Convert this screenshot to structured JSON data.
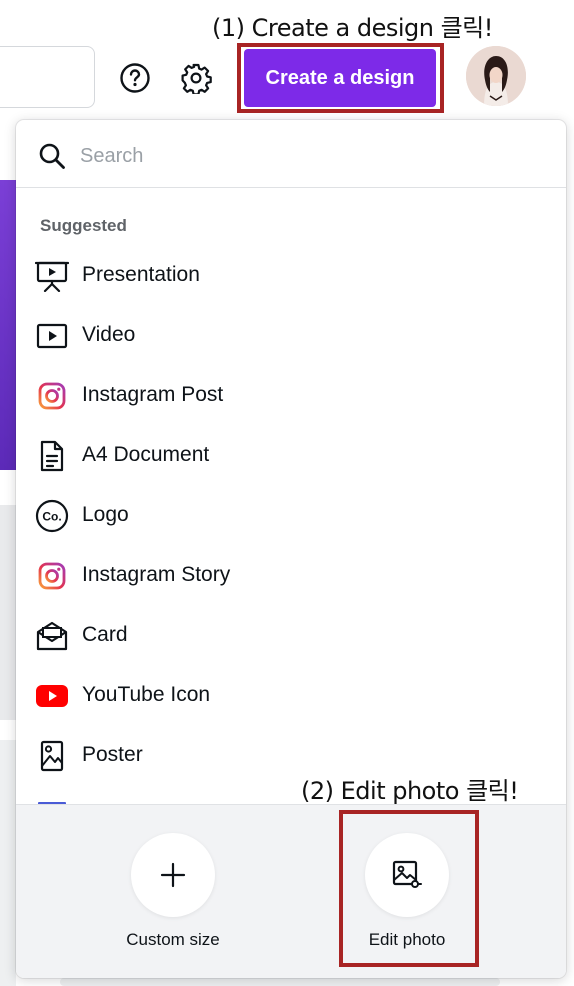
{
  "annotations": {
    "step1": "(1) Create a design 클릭!",
    "step2": "(2) Edit photo 클릭!"
  },
  "header": {
    "help_icon": "question-circle-icon",
    "settings_icon": "gear-icon",
    "create_button_label": "Create a design",
    "create_button_color": "#7d2ae8",
    "highlight_color": "#a82424"
  },
  "dropdown": {
    "search_placeholder": "Search",
    "section_label": "Suggested",
    "items": [
      {
        "label": "Presentation",
        "icon": "presentation-icon"
      },
      {
        "label": "Video",
        "icon": "video-icon"
      },
      {
        "label": "Instagram Post",
        "icon": "instagram-icon"
      },
      {
        "label": "A4 Document",
        "icon": "document-icon"
      },
      {
        "label": "Logo",
        "icon": "logo-co-icon"
      },
      {
        "label": "Instagram Story",
        "icon": "instagram-icon"
      },
      {
        "label": "Card",
        "icon": "card-envelope-icon"
      },
      {
        "label": "YouTube Icon",
        "icon": "youtube-icon"
      },
      {
        "label": "Poster",
        "icon": "poster-icon"
      }
    ],
    "footer": {
      "custom_size_label": "Custom size",
      "edit_photo_label": "Edit photo"
    }
  }
}
